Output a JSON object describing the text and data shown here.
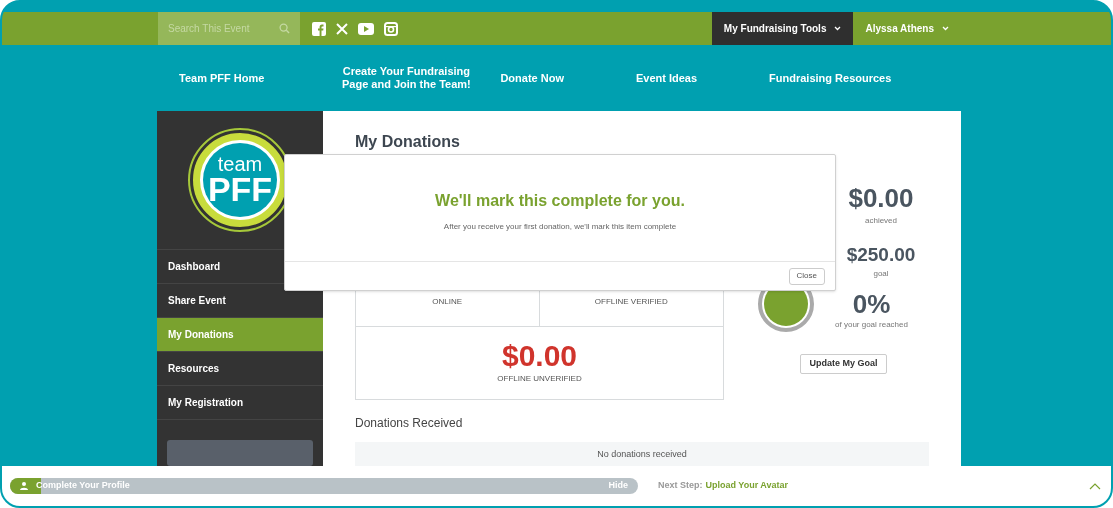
{
  "search": {
    "placeholder": "Search This Event"
  },
  "top_menus": [
    {
      "label": "My Fundraising Tools",
      "selected": true
    },
    {
      "label": "Alyssa Athens",
      "selected": false
    }
  ],
  "nav": [
    "Team PFF Home",
    "Create Your Fundraising Page and Join the Team!",
    "Donate Now",
    "Event Ideas",
    "Fundraising Resources"
  ],
  "logo": {
    "line1": "team",
    "line2": "PFF"
  },
  "sidebar": {
    "items": [
      {
        "label": "Dashboard",
        "selected": false
      },
      {
        "label": "Share Event",
        "selected": false
      },
      {
        "label": "My Donations",
        "selected": true
      },
      {
        "label": "Resources",
        "selected": false
      },
      {
        "label": "My Registration",
        "selected": false
      }
    ]
  },
  "page_title": "My Donations",
  "stats": [
    {
      "label": "ONLINE"
    },
    {
      "label": "OFFLINE VERIFIED"
    },
    {
      "amount": "$0.00",
      "label": "OFFLINE UNVERIFIED"
    }
  ],
  "summary": {
    "achieved": {
      "value": "$0.00",
      "label": "achieved"
    },
    "goal": {
      "value": "$250.00",
      "label": "goal"
    },
    "percent": {
      "value": "0%",
      "label": "of your goal reached"
    },
    "button": "Update My Goal"
  },
  "donations": {
    "title": "Donations Received",
    "empty": "No donations received"
  },
  "modal": {
    "title": "We'll mark this complete for you.",
    "message": "After you receive your first donation, we'll mark this item complete",
    "close": "Close"
  },
  "profile_bar": {
    "label": "Complete Your Profile",
    "level": 0.05,
    "hide": "Hide",
    "next_step_label": "Next Step:",
    "next_step": "Upload Your Avatar"
  }
}
